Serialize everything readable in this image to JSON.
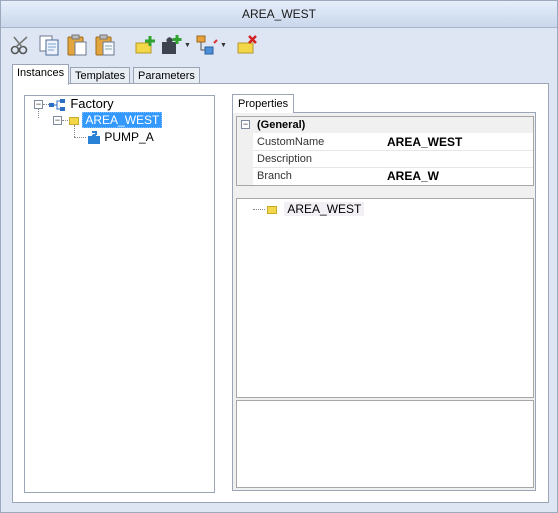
{
  "window": {
    "title": "AREA_WEST"
  },
  "toolbar": {
    "buttons": [
      {
        "name": "cut-icon"
      },
      {
        "name": "copy-icon"
      },
      {
        "name": "paste-icon"
      },
      {
        "name": "paste-special-icon"
      },
      {
        "name": "add-folder-icon"
      },
      {
        "name": "add-instance-icon",
        "dropdown": true
      },
      {
        "name": "add-branch-icon",
        "dropdown": true
      },
      {
        "name": "delete-icon"
      }
    ]
  },
  "tabs": [
    {
      "label": "Instances",
      "active": true
    },
    {
      "label": "Templates",
      "active": false
    },
    {
      "label": "Parameters",
      "active": false
    }
  ],
  "tree": {
    "root": "Factory",
    "child": "AREA_WEST",
    "grandchild": "PUMP_A"
  },
  "properties": {
    "tab_label": "Properties",
    "category": "(General)",
    "rows": [
      {
        "name": "CustomName",
        "value": "AREA_WEST"
      },
      {
        "name": "Description",
        "value": ""
      },
      {
        "name": "Branch",
        "value": "AREA_W"
      }
    ]
  },
  "lower_tree": {
    "item": "AREA_WEST"
  },
  "colors": {
    "selection": "#3399ff",
    "background": "#dde6f2"
  }
}
